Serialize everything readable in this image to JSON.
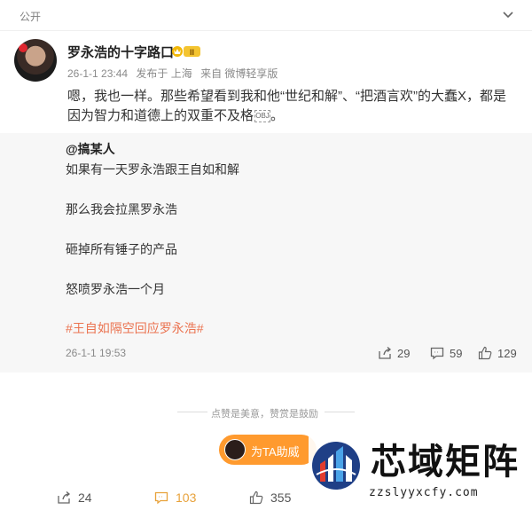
{
  "header": {
    "visibility": "公开"
  },
  "author": {
    "name": "罗永浩的十字路口",
    "vip_level": "II",
    "avatar_caption": "罗永浩的十字路口"
  },
  "post": {
    "time": "26-1-1 23:44",
    "sent_from": "发布于 上海",
    "source": "来自 微博轻享版",
    "text": "嗯，我也一样。那些希望看到我和他“世纪和解”、“把酒言欢”的大蠢X，都是因为智力和道德上的双重不及格",
    "emoji": "OBJ",
    "emoji_tail": "。"
  },
  "quoted": {
    "author": "@搞某人",
    "lines": [
      "如果有一天罗永浩跟王自如和解",
      "那么我会拉黑罗永浩",
      "砸掉所有锤子的产品",
      "怒喷罗永浩一个月"
    ],
    "hashtag": "#王自如隔空回应罗永浩#",
    "time": "26-1-1 19:53",
    "reposts": "29",
    "comments": "59",
    "likes": "129"
  },
  "reward": {
    "divider_text": "点赞是美意，赞赏是鼓励",
    "button_label": "为TA助威"
  },
  "actions": {
    "reposts": "24",
    "comments": "103",
    "likes": "355"
  },
  "watermark": {
    "title": "芯域矩阵",
    "url": "zzslyyxcfy.com"
  },
  "colors": {
    "accent": "#eb7350",
    "reward_bg": "#ff9a2e",
    "active_comment": "#e8a23b",
    "quote_bg": "#f7f7f7"
  },
  "icons": [
    "chevron-down-icon",
    "vip-badge-icon",
    "repost-icon",
    "comment-icon",
    "like-icon",
    "watermark-logo-icon"
  ]
}
